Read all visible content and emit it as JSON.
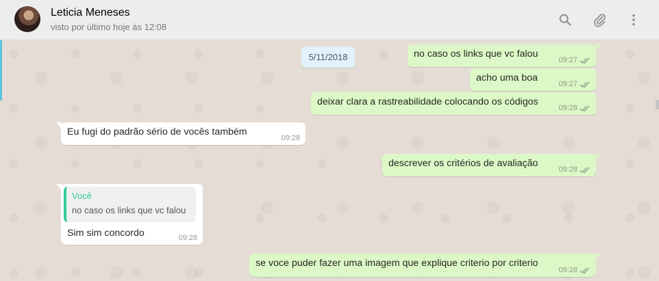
{
  "header": {
    "contact_name": "Leticia Meneses",
    "last_seen": "visto por último hoje às 12:08",
    "icons": [
      "search-icon",
      "paperclip-icon",
      "more-options-icon"
    ]
  },
  "colors": {
    "header_bg": "#ededed",
    "chat_bg": "#e5ddd5",
    "outgoing_bubble": "#dcf8c6",
    "incoming_bubble": "#ffffff",
    "date_chip": "#e1f2fb",
    "quote_accent": "#35cd96"
  },
  "date_chip": "5/11/2018",
  "messages": [
    {
      "direction": "out",
      "text": "no caso os links que vc falou",
      "time": "09:27",
      "status": "read"
    },
    {
      "direction": "out",
      "text": "acho uma boa",
      "time": "09:27",
      "status": "read"
    },
    {
      "direction": "out",
      "text": "deixar clara a rastreabilidade colocando os códigos",
      "time": "09:28",
      "status": "read"
    },
    {
      "direction": "in",
      "text": "Eu fugi do padrão sério de vocês também",
      "time": "09:28"
    },
    {
      "direction": "out",
      "text": "descrever os critérios de avaliação",
      "time": "09:28",
      "status": "read"
    },
    {
      "direction": "in",
      "quote": {
        "author": "Você",
        "text": "no caso os links que vc falou"
      },
      "text": "Sim sim concordo",
      "time": "09:28"
    },
    {
      "direction": "out",
      "text": "se voce puder fazer uma imagem que explique criterio por criterio",
      "time": "09:28",
      "status": "read"
    }
  ]
}
